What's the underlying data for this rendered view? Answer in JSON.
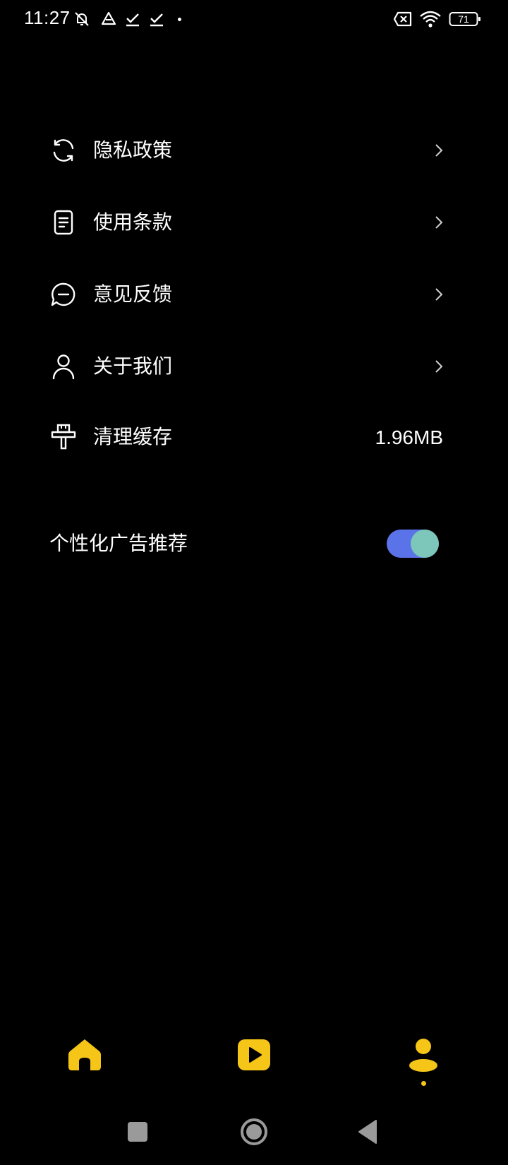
{
  "status_bar": {
    "time": "11:27",
    "battery_level": "71",
    "icons": [
      "mute-icon",
      "drive-icon",
      "download-done-icon",
      "download-done-icon",
      "dot-icon",
      "no-sim-icon",
      "wifi-icon",
      "battery-icon"
    ]
  },
  "settings": {
    "items": [
      {
        "label": "隐私政策",
        "icon": "refresh-icon"
      },
      {
        "label": "使用条款",
        "icon": "document-icon"
      },
      {
        "label": "意见反馈",
        "icon": "chat-bubble-icon"
      },
      {
        "label": "关于我们",
        "icon": "person-icon"
      },
      {
        "label": "清理缓存",
        "icon": "brush-icon",
        "value": "1.96MB"
      }
    ],
    "ad_recommendation": {
      "label": "个性化广告推荐",
      "enabled": true
    }
  },
  "bottom_nav": {
    "items": [
      "home-icon",
      "play-icon",
      "profile-icon"
    ],
    "active": "profile-icon"
  },
  "system_nav": [
    "recents-icon",
    "home-circle-icon",
    "back-icon"
  ],
  "colors": {
    "background": "#000000",
    "accent_yellow": "#f5c518",
    "toggle_track": "#5b73e8",
    "toggle_knob": "#7cc7b9",
    "system_button": "#9a9a9a"
  }
}
